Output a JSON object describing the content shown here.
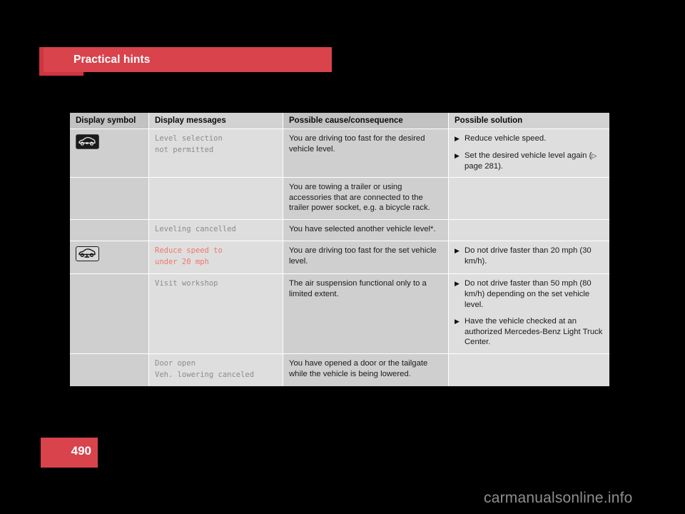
{
  "header": {
    "title": "Practical hints",
    "bar_color": "#d8434c",
    "accent_color": "#cf3440"
  },
  "page_number": "490",
  "watermark": "carmanualsonline.info",
  "table": {
    "columns": [
      "Display symbol",
      "Display messages",
      "Possible cause/consequence",
      "Possible solution"
    ],
    "rows": [
      {
        "symbol": "vehicle-level-not-permitted-icon",
        "message": "Level selection\nnot permitted",
        "message_style": "normal",
        "cause": "You are driving too fast for the desired vehicle level.",
        "solutions": [
          {
            "text": "Reduce vehicle speed."
          },
          {
            "text": "Set the desired vehicle level again (",
            "page_ref": "page 281",
            "text_after": ")."
          }
        ]
      },
      {
        "symbol": "",
        "message": "",
        "message_style": "normal",
        "cause": "You are towing a trailer or using accessories that are connected to the trailer power socket, e.g. a bicycle rack.",
        "solutions": []
      },
      {
        "symbol": "",
        "message": "Leveling cancelled",
        "message_style": "normal",
        "cause": "You have selected another vehicle level*.",
        "solutions": []
      },
      {
        "symbol": "vehicle-lowering-icon",
        "message": "Reduce speed to\nunder 20 mph",
        "message_style": "warn",
        "cause": "You are driving too fast for the set vehicle level.",
        "solutions": [
          {
            "text": "Do not drive faster than 20 mph (30 km/h)."
          }
        ]
      },
      {
        "symbol": "",
        "message": "Visit workshop",
        "message_style": "normal",
        "cause": "The air suspension functional only to a limited extent.",
        "solutions": [
          {
            "text": "Do not drive faster than 50 mph (80 km/h) depending on the set vehicle level."
          },
          {
            "text": "Have the vehicle checked at an authorized Mercedes-Benz Light Truck Center."
          }
        ]
      },
      {
        "symbol": "",
        "message": "Door open\nVeh. lowering canceled",
        "message_style": "normal",
        "cause": "You have opened a door or the tailgate while the vehicle is being lowered.",
        "solutions": []
      }
    ]
  },
  "colors": {
    "warn_text": "#f1766f",
    "message_text": "#8c8c8c",
    "body_text": "#1a1a1a",
    "col_dark": "#cfcfcf",
    "col_light": "#dedede",
    "header_cell": "#c2c2c2"
  },
  "icons": {
    "bullet": "▶",
    "page_ref_marker": "▷"
  }
}
